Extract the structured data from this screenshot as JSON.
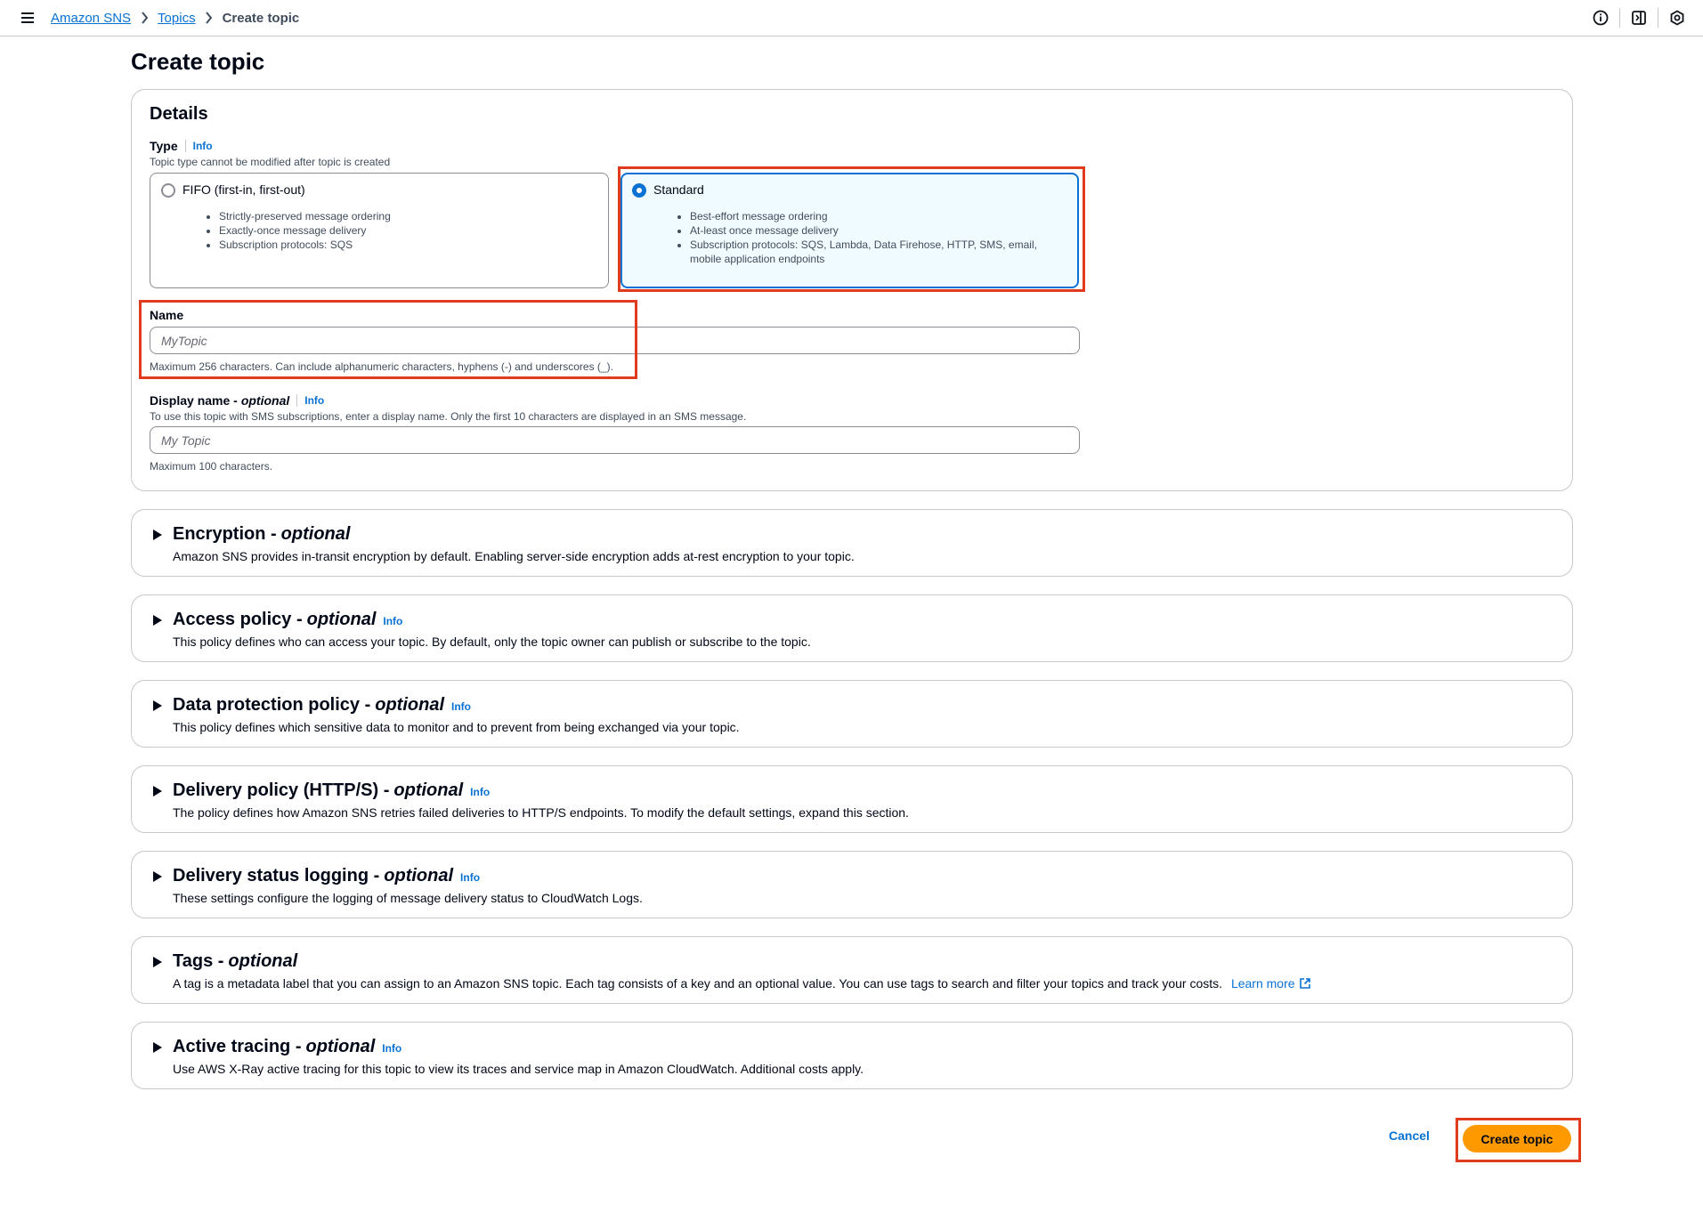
{
  "breadcrumb": {
    "items": [
      "Amazon SNS",
      "Topics"
    ],
    "current": "Create topic"
  },
  "icons": {
    "menu": "hamburger-icon",
    "info": "info-circle-icon",
    "notifications": "panel-icon",
    "settings": "gear-icon"
  },
  "page": {
    "title": "Create topic"
  },
  "details": {
    "heading": "Details",
    "type": {
      "label": "Type",
      "info": "Info",
      "description": "Topic type cannot be modified after topic is created",
      "options": [
        {
          "label": "FIFO (first-in, first-out)",
          "selected": false,
          "bullets": [
            "Strictly-preserved message ordering",
            "Exactly-once message delivery",
            "Subscription protocols: SQS"
          ]
        },
        {
          "label": "Standard",
          "selected": true,
          "bullets": [
            "Best-effort message ordering",
            "At-least once message delivery",
            "Subscription protocols: SQS, Lambda, Data Firehose, HTTP, SMS, email, mobile application endpoints"
          ]
        }
      ]
    },
    "name": {
      "label": "Name",
      "placeholder": "MyTopic",
      "value": "",
      "constraint": "Maximum 256 characters. Can include alphanumeric characters, hyphens (-) and underscores (_)."
    },
    "display_name": {
      "label": "Display name - ",
      "label_optional": "optional",
      "info": "Info",
      "description": "To use this topic with SMS subscriptions, enter a display name. Only the first 10 characters are displayed in an SMS message.",
      "placeholder": "My Topic",
      "value": "",
      "constraint": "Maximum 100 characters."
    }
  },
  "sections": [
    {
      "title": "Encryption - ",
      "optional": "optional",
      "info": "",
      "description": "Amazon SNS provides in-transit encryption by default. Enabling server-side encryption adds at-rest encryption to your topic."
    },
    {
      "title": "Access policy - ",
      "optional": "optional",
      "info": "Info",
      "description": "This policy defines who can access your topic. By default, only the topic owner can publish or subscribe to the topic."
    },
    {
      "title": "Data protection policy - ",
      "optional": "optional",
      "info": "Info",
      "description": "This policy defines which sensitive data to monitor and to prevent from being exchanged via your topic."
    },
    {
      "title": "Delivery policy (HTTP/S) - ",
      "optional": "optional",
      "info": "Info",
      "description": "The policy defines how Amazon SNS retries failed deliveries to HTTP/S endpoints. To modify the default settings, expand this section."
    },
    {
      "title": "Delivery status logging - ",
      "optional": "optional",
      "info": "Info",
      "description": "These settings configure the logging of message delivery status to CloudWatch Logs."
    },
    {
      "title": "Tags - ",
      "optional": "optional",
      "info": "",
      "description": "A tag is a metadata label that you can assign to an Amazon SNS topic. Each tag consists of a key and an optional value. You can use tags to search and filter your topics and track your costs.",
      "link": "Learn more"
    },
    {
      "title": "Active tracing - ",
      "optional": "optional",
      "info": "Info",
      "description": "Use AWS X-Ray active tracing for this topic to view its traces and service map in Amazon CloudWatch. Additional costs apply."
    }
  ],
  "actions": {
    "cancel": "Cancel",
    "create": "Create topic"
  },
  "colors": {
    "primary": "#ff9900",
    "link": "#0972d3",
    "highlight": "#e03a1f",
    "border": "#c6c6cd"
  }
}
